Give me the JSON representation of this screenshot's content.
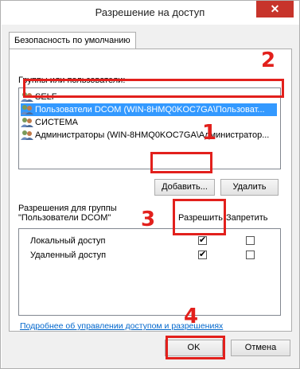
{
  "window": {
    "title": "Разрешение на доступ",
    "close_glyph": "✕"
  },
  "tab": {
    "label": "Безопасность по умолчанию"
  },
  "groups": {
    "label": "Группы или пользователи:",
    "items": [
      {
        "label": "SELF",
        "icon": "user-group-icon"
      },
      {
        "label": "Пользователи DCOM (WIN-8HMQ0KOC7GA\\Пользоват...",
        "icon": "user-group-icon",
        "selected": true
      },
      {
        "label": "СИСТЕМА",
        "icon": "user-group-icon"
      },
      {
        "label": "Администраторы (WIN-8HMQ0KOC7GA\\Администратор...",
        "icon": "user-group-icon"
      }
    ]
  },
  "buttons": {
    "add": "Добавить...",
    "remove": "Удалить",
    "ok": "OK",
    "cancel": "Отмена"
  },
  "permissions": {
    "label_line1": "Разрешения для группы",
    "label_line2": "\"Пользователи DCOM\"",
    "allow_header": "Разрешить",
    "deny_header": "Запретить",
    "rows": [
      {
        "label": "Локальный доступ",
        "allow": true,
        "deny": false
      },
      {
        "label": "Удаленный доступ",
        "allow": true,
        "deny": false
      }
    ]
  },
  "link": {
    "text": "Подробнее об управлении доступом и разрешениях"
  },
  "annotations": {
    "n1": "1",
    "n2": "2",
    "n3": "3",
    "n4": "4",
    "color": "#e2201c"
  },
  "check_glyph": "✔"
}
